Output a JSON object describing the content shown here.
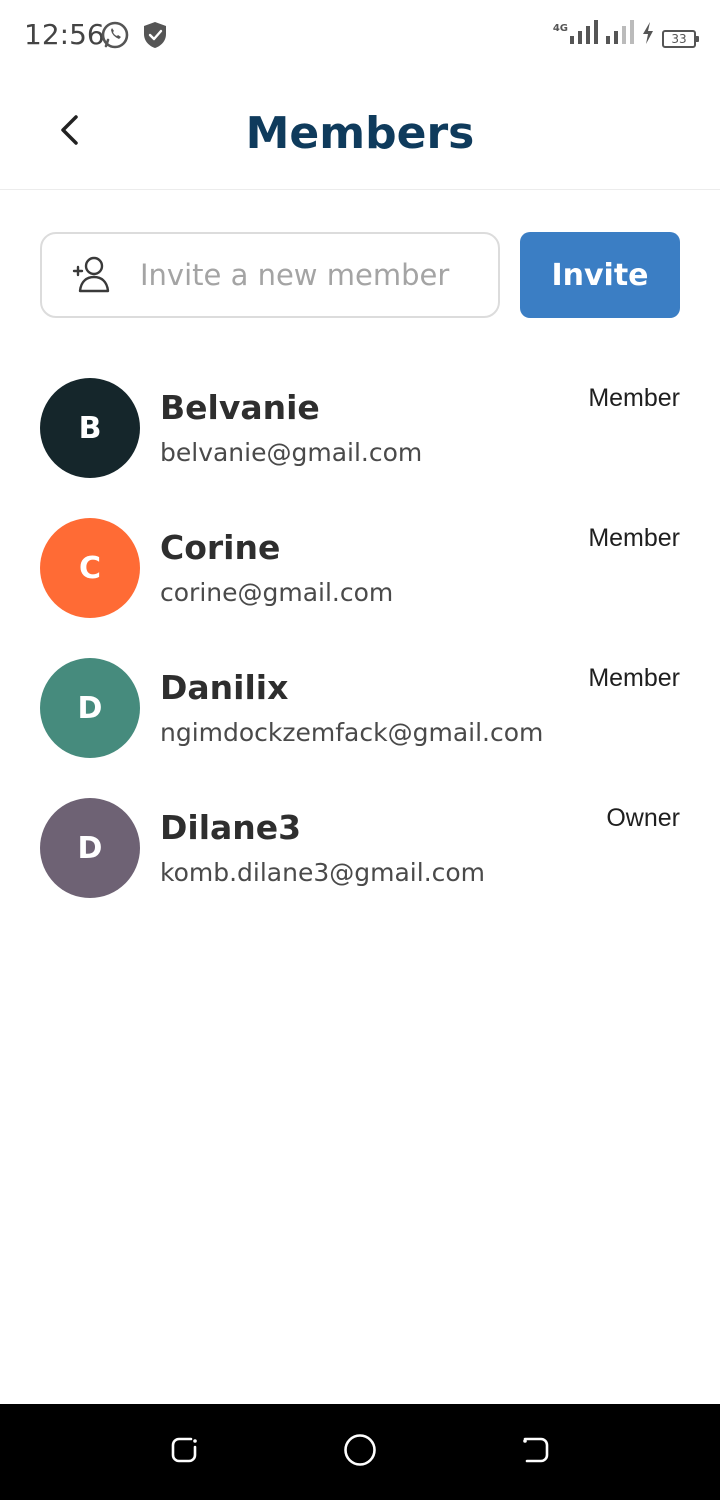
{
  "status_bar": {
    "time": "12:56",
    "network_label": "4G",
    "battery": "33"
  },
  "header": {
    "title": "Members"
  },
  "invite": {
    "placeholder": "Invite a new member",
    "button_label": "Invite"
  },
  "members": [
    {
      "initial": "B",
      "name": "Belvanie",
      "email": "belvanie@gmail.com",
      "role": "Member",
      "color": "#15262b"
    },
    {
      "initial": "C",
      "name": "Corine",
      "email": "corine@gmail.com",
      "role": "Member",
      "color": "#ff6b35"
    },
    {
      "initial": "D",
      "name": "Danilix",
      "email": "ngimdockzemfack@gmail.com",
      "role": "Member",
      "color": "#468b7d"
    },
    {
      "initial": "D",
      "name": "Dilane3",
      "email": "komb.dilane3@gmail.com",
      "role": "Owner",
      "color": "#6e6274"
    }
  ],
  "colors": {
    "title": "#0f3b5c",
    "accent": "#3b7ec4"
  }
}
